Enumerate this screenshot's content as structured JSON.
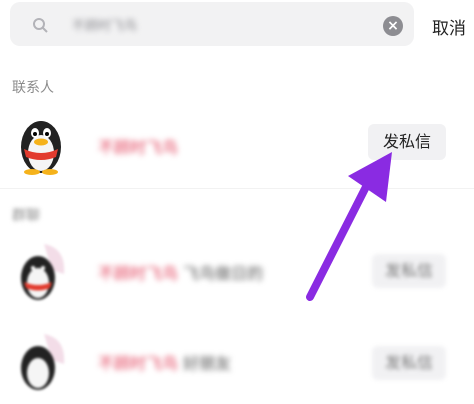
{
  "search": {
    "query": "不顾时飞鸟"
  },
  "header": {
    "cancel_label": "取消"
  },
  "sections": {
    "contacts_title": "联系人",
    "groups_title": "群聊"
  },
  "contacts": [
    {
      "name": "不顾时飞鸟",
      "extra": "",
      "action": "发私信"
    }
  ],
  "groups": [
    {
      "name": "不顾时飞鸟",
      "extra": "飞鸟做日的",
      "action": "发私信"
    },
    {
      "name": "不顾时飞鸟",
      "extra": "好朋友",
      "action": "发私信"
    }
  ],
  "colors": {
    "name_highlight": "#e2415b",
    "arrow": "#8a2be2",
    "search_bg": "#f2f2f3"
  },
  "icons": [
    "search-icon",
    "clear-icon",
    "penguin-avatar-icon",
    "arrow-annotation-icon"
  ]
}
